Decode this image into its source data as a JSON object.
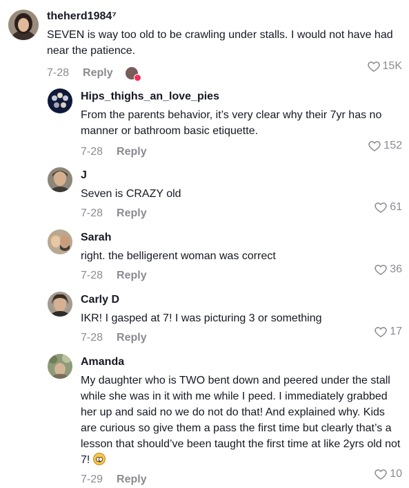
{
  "comments": [
    {
      "username": "theherd1984⁷",
      "text": "SEVEN is way too old to be crawling under stalls. I would not have had near the patience.",
      "date": "7-28",
      "reply": "Reply",
      "likes": "15K",
      "creator_liked": true
    },
    {
      "username": "Hips_thighs_an_love_pies",
      "text": "From the parents behavior, it’s very clear why their 7yr has no manner or bathroom basic etiquette.",
      "date": "7-28",
      "reply": "Reply",
      "likes": "152"
    },
    {
      "username": "J",
      "text": "Seven is CRAZY old",
      "date": "7-28",
      "reply": "Reply",
      "likes": "61"
    },
    {
      "username": "Sarah",
      "text": "right. the belligerent woman was correct",
      "date": "7-28",
      "reply": "Reply",
      "likes": "36"
    },
    {
      "username": "Carly D",
      "text": "IKR! I gasped at 7! I was picturing 3 or something",
      "date": "7-28",
      "reply": "Reply",
      "likes": "17"
    },
    {
      "username": "Amanda",
      "text": "My daughter who is TWO bent down and peered under the stall while she was in it with me while I peed. I immediately grabbed her up and said no we do not do that! And explained why. Kids are curious so give them a pass the first time but clearly that’s a lesson that should’ve been taught the first time at like 2yrs old not 7!",
      "date": "7-29",
      "reply": "Reply",
      "likes": "10",
      "emoji": "flushed-face"
    }
  ],
  "colors": {
    "text": "#161823",
    "muted": "#8a8b91",
    "accent": "#fe2c55"
  },
  "icons": {
    "like": "heart-outline-icon",
    "creator_like_badge": "heart-badge-icon"
  }
}
